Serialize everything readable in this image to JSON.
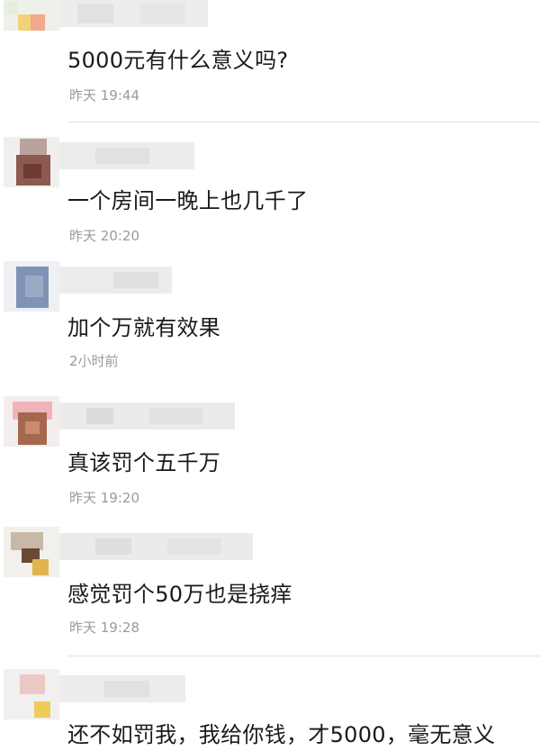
{
  "comments": [
    {
      "text": "5000元有什么意义吗?",
      "time": "昨天 19:44"
    },
    {
      "text": "一个房间一晚上也几千了",
      "time": "昨天 20:20"
    },
    {
      "text": "加个万就有效果",
      "time": "2小时前"
    },
    {
      "text": "真该罚个五千万",
      "time": "昨天 19:20"
    },
    {
      "text": "感觉罚个50万也是挠痒",
      "time": "昨天 19:28"
    },
    {
      "text": "还不如罚我，我给你钱，才5000，毫无意义",
      "time": ""
    }
  ]
}
